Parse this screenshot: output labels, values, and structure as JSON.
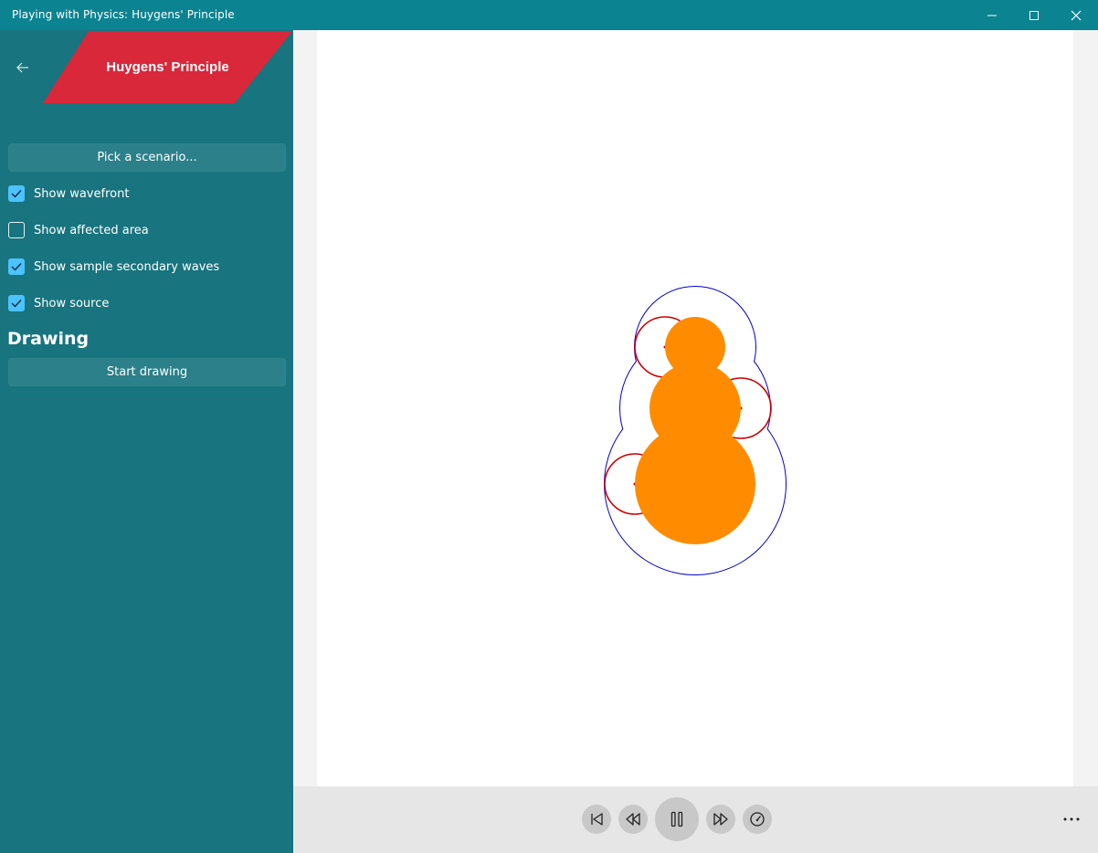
{
  "window": {
    "title": "Playing with Physics: Huygens' Principle"
  },
  "sidebar": {
    "banner_title": "Huygens' Principle",
    "pick_scenario_label": "Pick a scenario...",
    "options": [
      {
        "label": "Show wavefront",
        "checked": true
      },
      {
        "label": "Show affected area",
        "checked": false
      },
      {
        "label": "Show sample secondary waves",
        "checked": true
      },
      {
        "label": "Show source",
        "checked": true
      }
    ],
    "drawing_heading": "Drawing",
    "start_drawing_label": "Start drawing"
  },
  "colors": {
    "titlebar": "#0b8391",
    "sidebar": "#18747e",
    "banner": "#d8283a",
    "checkbox_on": "#4cc2ff",
    "source": "#ff8c00",
    "wavefront": "#0000cc",
    "secondary_wave": "#cc0000"
  },
  "controls": {
    "icons": [
      "skip-to-start-icon",
      "rewind-icon",
      "pause-icon",
      "fast-forward-icon",
      "speed-gauge-icon",
      "more-icon"
    ]
  }
}
